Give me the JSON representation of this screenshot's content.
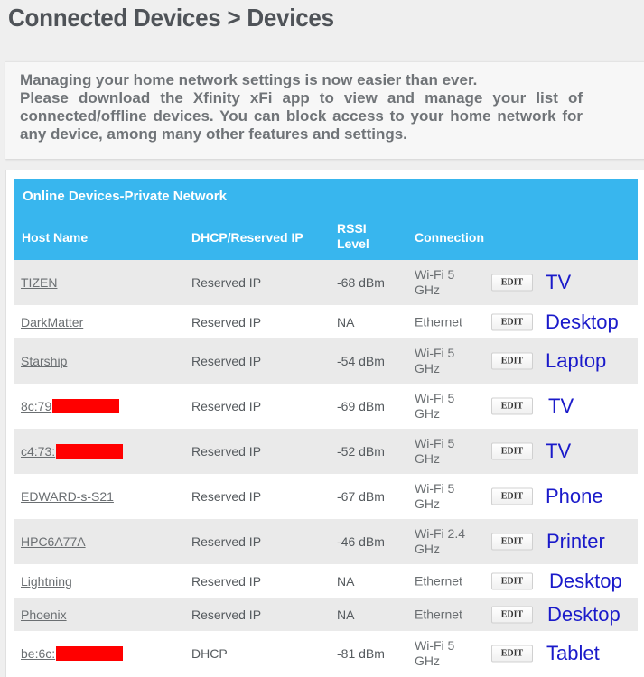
{
  "page": {
    "title": "Connected Devices > Devices"
  },
  "notice": {
    "line1": "Managing your home network settings is now easier than ever.",
    "line2": "Please download the Xfinity xFi app to view and manage your list of connected/offline devices. You can block access to your home network for any device, among many other features and settings."
  },
  "table": {
    "caption": "Online Devices-Private Network",
    "headers": {
      "host": "Host Name",
      "ip": "DHCP/Reserved IP",
      "rssi": "RSSI Level",
      "connection": "Connection"
    },
    "edit_label": "EDIT",
    "rows": [
      {
        "host": "TIZEN",
        "redacted": false,
        "ip": "Reserved IP",
        "rssi": "-68 dBm",
        "connection": "Wi-Fi 5 GHz",
        "annotation": "TV",
        "shade": "gray"
      },
      {
        "host": "DarkMatter",
        "redacted": false,
        "ip": "Reserved IP",
        "rssi": "NA",
        "connection": "Ethernet",
        "annotation": "Desktop",
        "shade": "white"
      },
      {
        "host": "Starship",
        "redacted": false,
        "ip": "Reserved IP",
        "rssi": "-54 dBm",
        "connection": "Wi-Fi 5 GHz",
        "annotation": "Laptop",
        "shade": "gray"
      },
      {
        "host": "8c:79",
        "redacted": true,
        "ip": "Reserved IP",
        "rssi": "-69 dBm",
        "connection": "Wi-Fi 5 GHz",
        "annotation": "TV",
        "shade": "white"
      },
      {
        "host": "c4:73:",
        "redacted": true,
        "ip": "Reserved IP",
        "rssi": "-52 dBm",
        "connection": "Wi-Fi 5 GHz",
        "annotation": "TV",
        "shade": "gray"
      },
      {
        "host": "EDWARD-s-S21",
        "redacted": false,
        "ip": "Reserved IP",
        "rssi": "-67 dBm",
        "connection": "Wi-Fi 5 GHz",
        "annotation": "Phone",
        "shade": "white"
      },
      {
        "host": "HPC6A77A",
        "redacted": false,
        "ip": "Reserved IP",
        "rssi": "-46 dBm",
        "connection": "Wi-Fi 2.4 GHz",
        "annotation": "Printer",
        "shade": "gray"
      },
      {
        "host": "Lightning",
        "redacted": false,
        "ip": "Reserved IP",
        "rssi": "NA",
        "connection": "Ethernet",
        "annotation": "Desktop",
        "shade": "white"
      },
      {
        "host": "Phoenix",
        "redacted": false,
        "ip": "Reserved IP",
        "rssi": "NA",
        "connection": "Ethernet",
        "annotation": "Desktop",
        "shade": "gray"
      },
      {
        "host": "be:6c:",
        "redacted": true,
        "ip": "DHCP",
        "rssi": "-81 dBm",
        "connection": "Wi-Fi 5 GHz",
        "annotation": "Tablet",
        "shade": "white"
      }
    ]
  },
  "colors": {
    "header_bg": "#38b6ee",
    "annotation": "#1a1aca",
    "redaction": "#ff0000"
  }
}
